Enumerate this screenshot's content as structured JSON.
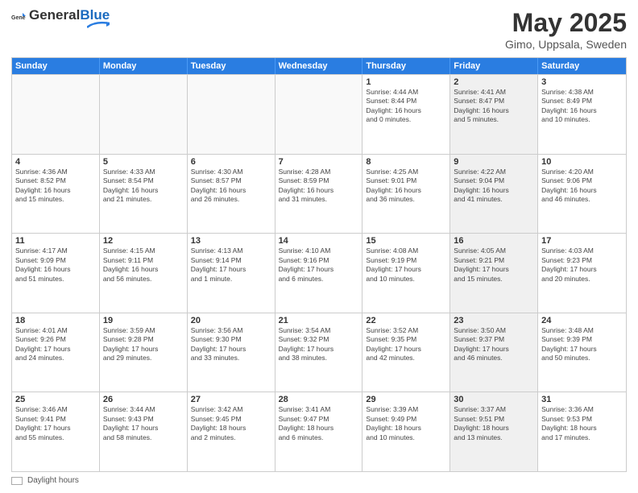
{
  "header": {
    "logo_general": "General",
    "logo_blue": "Blue",
    "month": "May 2025",
    "location": "Gimo, Uppsala, Sweden"
  },
  "weekdays": [
    "Sunday",
    "Monday",
    "Tuesday",
    "Wednesday",
    "Thursday",
    "Friday",
    "Saturday"
  ],
  "rows": [
    [
      {
        "day": "",
        "info": "",
        "shaded": false,
        "empty": true
      },
      {
        "day": "",
        "info": "",
        "shaded": false,
        "empty": true
      },
      {
        "day": "",
        "info": "",
        "shaded": false,
        "empty": true
      },
      {
        "day": "",
        "info": "",
        "shaded": false,
        "empty": true
      },
      {
        "day": "1",
        "info": "Sunrise: 4:44 AM\nSunset: 8:44 PM\nDaylight: 16 hours\nand 0 minutes.",
        "shaded": false,
        "empty": false
      },
      {
        "day": "2",
        "info": "Sunrise: 4:41 AM\nSunset: 8:47 PM\nDaylight: 16 hours\nand 5 minutes.",
        "shaded": true,
        "empty": false
      },
      {
        "day": "3",
        "info": "Sunrise: 4:38 AM\nSunset: 8:49 PM\nDaylight: 16 hours\nand 10 minutes.",
        "shaded": false,
        "empty": false
      }
    ],
    [
      {
        "day": "4",
        "info": "Sunrise: 4:36 AM\nSunset: 8:52 PM\nDaylight: 16 hours\nand 15 minutes.",
        "shaded": false,
        "empty": false
      },
      {
        "day": "5",
        "info": "Sunrise: 4:33 AM\nSunset: 8:54 PM\nDaylight: 16 hours\nand 21 minutes.",
        "shaded": false,
        "empty": false
      },
      {
        "day": "6",
        "info": "Sunrise: 4:30 AM\nSunset: 8:57 PM\nDaylight: 16 hours\nand 26 minutes.",
        "shaded": false,
        "empty": false
      },
      {
        "day": "7",
        "info": "Sunrise: 4:28 AM\nSunset: 8:59 PM\nDaylight: 16 hours\nand 31 minutes.",
        "shaded": false,
        "empty": false
      },
      {
        "day": "8",
        "info": "Sunrise: 4:25 AM\nSunset: 9:01 PM\nDaylight: 16 hours\nand 36 minutes.",
        "shaded": false,
        "empty": false
      },
      {
        "day": "9",
        "info": "Sunrise: 4:22 AM\nSunset: 9:04 PM\nDaylight: 16 hours\nand 41 minutes.",
        "shaded": true,
        "empty": false
      },
      {
        "day": "10",
        "info": "Sunrise: 4:20 AM\nSunset: 9:06 PM\nDaylight: 16 hours\nand 46 minutes.",
        "shaded": false,
        "empty": false
      }
    ],
    [
      {
        "day": "11",
        "info": "Sunrise: 4:17 AM\nSunset: 9:09 PM\nDaylight: 16 hours\nand 51 minutes.",
        "shaded": false,
        "empty": false
      },
      {
        "day": "12",
        "info": "Sunrise: 4:15 AM\nSunset: 9:11 PM\nDaylight: 16 hours\nand 56 minutes.",
        "shaded": false,
        "empty": false
      },
      {
        "day": "13",
        "info": "Sunrise: 4:13 AM\nSunset: 9:14 PM\nDaylight: 17 hours\nand 1 minute.",
        "shaded": false,
        "empty": false
      },
      {
        "day": "14",
        "info": "Sunrise: 4:10 AM\nSunset: 9:16 PM\nDaylight: 17 hours\nand 6 minutes.",
        "shaded": false,
        "empty": false
      },
      {
        "day": "15",
        "info": "Sunrise: 4:08 AM\nSunset: 9:19 PM\nDaylight: 17 hours\nand 10 minutes.",
        "shaded": false,
        "empty": false
      },
      {
        "day": "16",
        "info": "Sunrise: 4:05 AM\nSunset: 9:21 PM\nDaylight: 17 hours\nand 15 minutes.",
        "shaded": true,
        "empty": false
      },
      {
        "day": "17",
        "info": "Sunrise: 4:03 AM\nSunset: 9:23 PM\nDaylight: 17 hours\nand 20 minutes.",
        "shaded": false,
        "empty": false
      }
    ],
    [
      {
        "day": "18",
        "info": "Sunrise: 4:01 AM\nSunset: 9:26 PM\nDaylight: 17 hours\nand 24 minutes.",
        "shaded": false,
        "empty": false
      },
      {
        "day": "19",
        "info": "Sunrise: 3:59 AM\nSunset: 9:28 PM\nDaylight: 17 hours\nand 29 minutes.",
        "shaded": false,
        "empty": false
      },
      {
        "day": "20",
        "info": "Sunrise: 3:56 AM\nSunset: 9:30 PM\nDaylight: 17 hours\nand 33 minutes.",
        "shaded": false,
        "empty": false
      },
      {
        "day": "21",
        "info": "Sunrise: 3:54 AM\nSunset: 9:32 PM\nDaylight: 17 hours\nand 38 minutes.",
        "shaded": false,
        "empty": false
      },
      {
        "day": "22",
        "info": "Sunrise: 3:52 AM\nSunset: 9:35 PM\nDaylight: 17 hours\nand 42 minutes.",
        "shaded": false,
        "empty": false
      },
      {
        "day": "23",
        "info": "Sunrise: 3:50 AM\nSunset: 9:37 PM\nDaylight: 17 hours\nand 46 minutes.",
        "shaded": true,
        "empty": false
      },
      {
        "day": "24",
        "info": "Sunrise: 3:48 AM\nSunset: 9:39 PM\nDaylight: 17 hours\nand 50 minutes.",
        "shaded": false,
        "empty": false
      }
    ],
    [
      {
        "day": "25",
        "info": "Sunrise: 3:46 AM\nSunset: 9:41 PM\nDaylight: 17 hours\nand 55 minutes.",
        "shaded": false,
        "empty": false
      },
      {
        "day": "26",
        "info": "Sunrise: 3:44 AM\nSunset: 9:43 PM\nDaylight: 17 hours\nand 58 minutes.",
        "shaded": false,
        "empty": false
      },
      {
        "day": "27",
        "info": "Sunrise: 3:42 AM\nSunset: 9:45 PM\nDaylight: 18 hours\nand 2 minutes.",
        "shaded": false,
        "empty": false
      },
      {
        "day": "28",
        "info": "Sunrise: 3:41 AM\nSunset: 9:47 PM\nDaylight: 18 hours\nand 6 minutes.",
        "shaded": false,
        "empty": false
      },
      {
        "day": "29",
        "info": "Sunrise: 3:39 AM\nSunset: 9:49 PM\nDaylight: 18 hours\nand 10 minutes.",
        "shaded": false,
        "empty": false
      },
      {
        "day": "30",
        "info": "Sunrise: 3:37 AM\nSunset: 9:51 PM\nDaylight: 18 hours\nand 13 minutes.",
        "shaded": true,
        "empty": false
      },
      {
        "day": "31",
        "info": "Sunrise: 3:36 AM\nSunset: 9:53 PM\nDaylight: 18 hours\nand 17 minutes.",
        "shaded": false,
        "empty": false
      }
    ]
  ],
  "footer": {
    "daylight_label": "Daylight hours"
  }
}
